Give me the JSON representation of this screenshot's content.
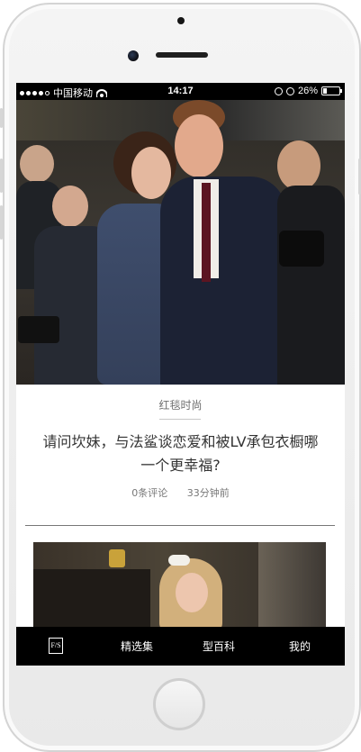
{
  "status_bar": {
    "carrier": "中国移动",
    "time": "14:17",
    "battery": "26%",
    "battery_level": 0.26
  },
  "article": {
    "category": "红毯时尚",
    "title_line1": "请问坎妹，与法鲨谈恋爱和被LV承包衣橱哪",
    "title_line2": "一个更幸福?",
    "comments": "0条评论",
    "time_ago": "33分钟前"
  },
  "tab_bar": {
    "logo_icon": "brand-logo-icon",
    "logo_text": "F/S",
    "tabs": [
      {
        "label": "精选集"
      },
      {
        "label": "型百科"
      },
      {
        "label": "我的"
      }
    ]
  },
  "colors": {
    "tab_bar_bg": "#000000",
    "text_primary": "#333333",
    "text_secondary": "#777777"
  }
}
